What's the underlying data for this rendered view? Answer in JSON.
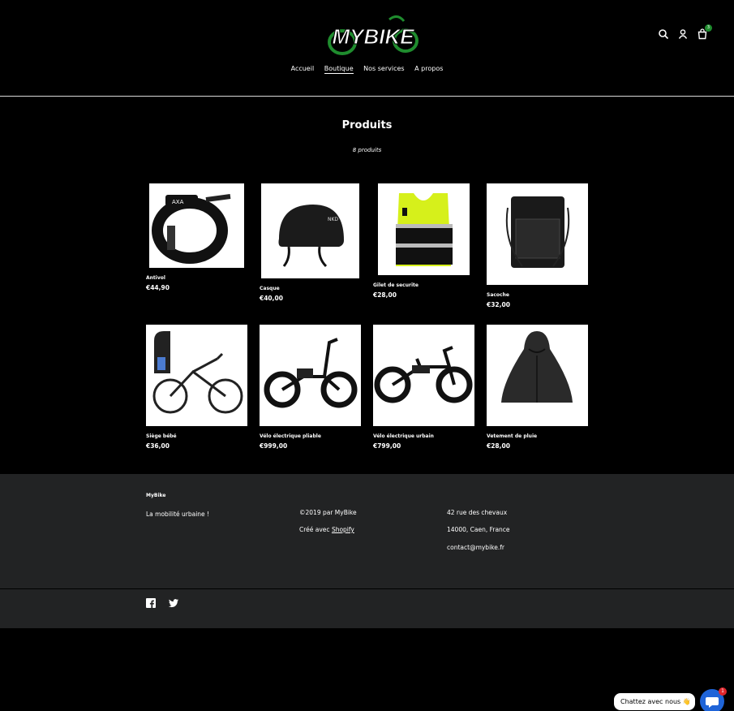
{
  "header": {
    "logo_text": "MYBIKE",
    "cart_count": "3",
    "nav": [
      {
        "label": "Accueil",
        "active": false
      },
      {
        "label": "Boutique",
        "active": true
      },
      {
        "label": "Nos services",
        "active": false
      },
      {
        "label": "A propos",
        "active": false
      }
    ]
  },
  "main": {
    "title": "Produits",
    "count": "8 produits",
    "products": [
      {
        "name": "Antivol",
        "price": "€44,90",
        "icon": "bike-lock-image"
      },
      {
        "name": "Casque",
        "price": "€40,00",
        "icon": "helmet-image"
      },
      {
        "name": "Gilet de securite",
        "price": "€28,00",
        "icon": "safety-vest-image"
      },
      {
        "name": "Sacoche",
        "price": "€32,00",
        "icon": "pannier-bag-image"
      },
      {
        "name": "Siège bébé",
        "price": "€36,00",
        "icon": "baby-seat-bike-image"
      },
      {
        "name": "Vélo électrique pliable",
        "price": "€999,00",
        "icon": "folding-ebike-image"
      },
      {
        "name": "Vélo électrique urbain",
        "price": "€799,00",
        "icon": "urban-ebike-image"
      },
      {
        "name": "Vetement de pluie",
        "price": "€28,00",
        "icon": "rain-poncho-image"
      }
    ]
  },
  "footer": {
    "brand": "MyBike",
    "tagline": "La mobilité urbaine !",
    "copyright": "©2019 par MyBike",
    "created_prefix": "Créé avec",
    "created_link": "Shopify",
    "address1": "42 rue des chevaux",
    "address2": "14000, Caen, France",
    "email": "contact@mybike.fr"
  },
  "chat": {
    "label": "Chattez avec nous 👋",
    "badge": "1"
  },
  "colors": {
    "background": "#000000",
    "footer": "#222324",
    "brand_green": "#1f8c2e",
    "chat_blue": "#1f64d8"
  }
}
